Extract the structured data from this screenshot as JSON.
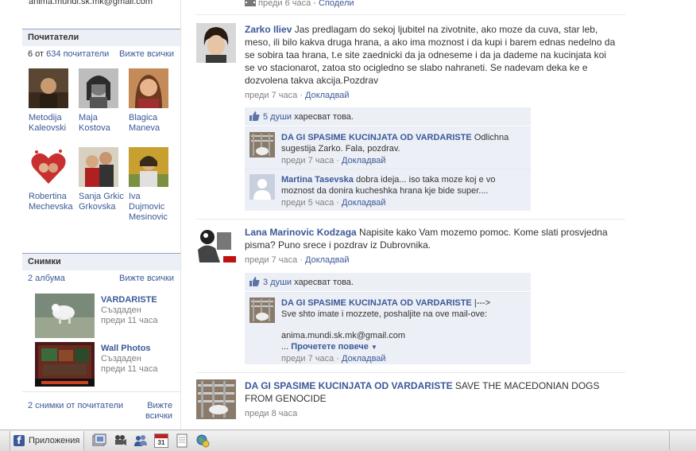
{
  "left": {
    "email": "anima.mundi.sk.mk@gmail.com",
    "fans": {
      "title": "Почитатели",
      "count_prefix": "6 от",
      "count_link": "634 почитатели",
      "see_all": "Вижте всички",
      "people": [
        {
          "first": "Metodija",
          "last": "Kaleovski"
        },
        {
          "first": "Maja",
          "last": "Kostova"
        },
        {
          "first": "Blagica",
          "last": "Maneva"
        },
        {
          "first": "Robertina",
          "last": "Mechevska"
        },
        {
          "first": "Sanja Grkic",
          "last": "Grkovska"
        },
        {
          "first": "Iva",
          "last": "Dujmovic Mesinovic"
        }
      ]
    },
    "photos": {
      "title": "Снимки",
      "albums_link": "2 албума",
      "see_all": "Вижте всички",
      "albums": [
        {
          "name": "VARDARISTE",
          "created": "Създаден",
          "time": "преди 11 часа"
        },
        {
          "name": "Wall Photos",
          "created": "Създаден",
          "time": "преди 11 часа"
        }
      ],
      "fan_photos_link": "2 снимки от почитатели",
      "see_all_2a": "Вижте",
      "see_all_2b": "всички"
    }
  },
  "feed": {
    "top_meta": {
      "time": "преди 6 часа",
      "share": "Сподели"
    },
    "stories": [
      {
        "author": "Zarko Iliev",
        "text": "Jas predlagam do sekoj ljubitel na zivotnite, ako moze da cuva, star leb, meso, ili bilo kakva druga hrana, a ako ima moznost i da kupi i barem ednas nedelno da se sobira taa hrana, t.e site zaednicki da ja odneseme i da ja dademe na kucinjata koi se vo stacionarot, zatoa sto ocigledno se slabo nahraneti. Se nadevam deka ke e dozvolena takva akcija.Pozdrav",
        "time": "преди 7 часа",
        "comment_link": "Докладвай",
        "likes_link": "5 души",
        "likes_text": "харесват това.",
        "comments": [
          {
            "author": "DA GI SPASIME KUCINJATA OD VARDARISTE",
            "text": "Odlichna sugestija Zarko. Fala, pozdrav.",
            "time": "преди 7 часа",
            "report": "Докладвай"
          },
          {
            "author": "Martina Tasevska",
            "text": "dobra ideja... iso taka moze koj e vo moznost da donira kucheshka hrana kje bide super....",
            "time": "преди 5 часа",
            "report": "Докладвай"
          }
        ]
      },
      {
        "author": "Lana Marinovic Kodzaga",
        "text": "Napisite kako Vam mozemo pomoc. Kome slati prosvjedna pisma? Puno srece i pozdrav iz Dubrovnika.",
        "time": "преди 7 часа",
        "comment_link": "Докладвай",
        "likes_link": "3 души",
        "likes_text": "харесват това.",
        "comments": [
          {
            "author": "DA GI SPASIME KUCINJATA OD VARDARISTE",
            "author_suffix": "|--->",
            "line1": "Sve shto imate i mozzete, poshaljite na ove mail-ove:",
            "line2": "anima.mundi.sk.mk@gmail.com",
            "more_prefix": "...",
            "more_link": "Прочетете повече",
            "time": "преди 7 часа",
            "report": "Докладвай"
          }
        ]
      },
      {
        "author": "DA GI SPASIME KUCINJATA OD VARDARISTE",
        "text": "SAVE THE MACEDONIAN DOGS FROM GENOCIDE",
        "time": "преди 8 часа"
      }
    ]
  },
  "bottombar": {
    "apps_label": "Приложения",
    "calendar_num": "31"
  }
}
